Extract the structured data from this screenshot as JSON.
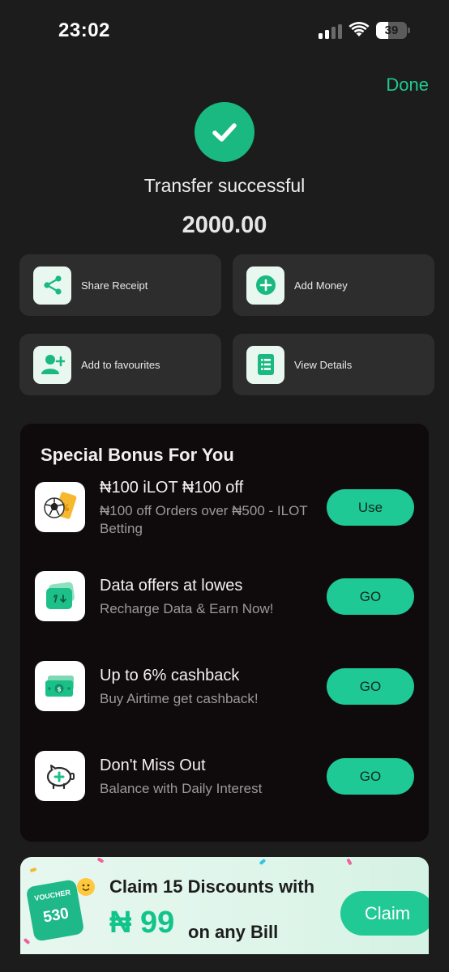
{
  "status_bar": {
    "time": "23:02",
    "battery_level": "39",
    "battery_fraction": 0.39
  },
  "header": {
    "done_label": "Done"
  },
  "result": {
    "title": "Transfer successful",
    "amount": "2000.00"
  },
  "actions": [
    {
      "label": "Share Receipt",
      "icon": "share-icon"
    },
    {
      "label": "Add Money",
      "icon": "plus-circle-icon"
    },
    {
      "label": "Add to favourites",
      "icon": "add-user-icon"
    },
    {
      "label": "View Details",
      "icon": "details-list-icon"
    }
  ],
  "bonus": {
    "title": "Special Bonus For You",
    "offers": [
      {
        "title": "₦100 iLOT ₦100 off",
        "subtitle": "₦100 off Orders over ₦500 - ILOT Betting",
        "button": "Use",
        "icon": "betting-ticket-icon"
      },
      {
        "title": "Data offers at lowes",
        "subtitle": "Recharge Data & Earn Now!",
        "button": "GO",
        "icon": "data-card-icon"
      },
      {
        "title": "Up to 6% cashback",
        "subtitle": "Buy Airtime get cashback!",
        "button": "GO",
        "icon": "cash-icon"
      },
      {
        "title": "Don't Miss Out",
        "subtitle": "Balance with Daily Interest",
        "button": "GO",
        "icon": "piggy-bank-icon"
      }
    ]
  },
  "banner": {
    "line1": "Claim 15 Discounts with",
    "currency": "₦",
    "amount": "99",
    "suffix": "on any Bill",
    "button": "Claim",
    "voucher_label": "VOUCHER",
    "voucher_value": "530"
  },
  "colors": {
    "accent": "#1ec995",
    "background": "#1c1c1c",
    "tile": "#2d2d2d",
    "card": "#0f0a0c"
  }
}
